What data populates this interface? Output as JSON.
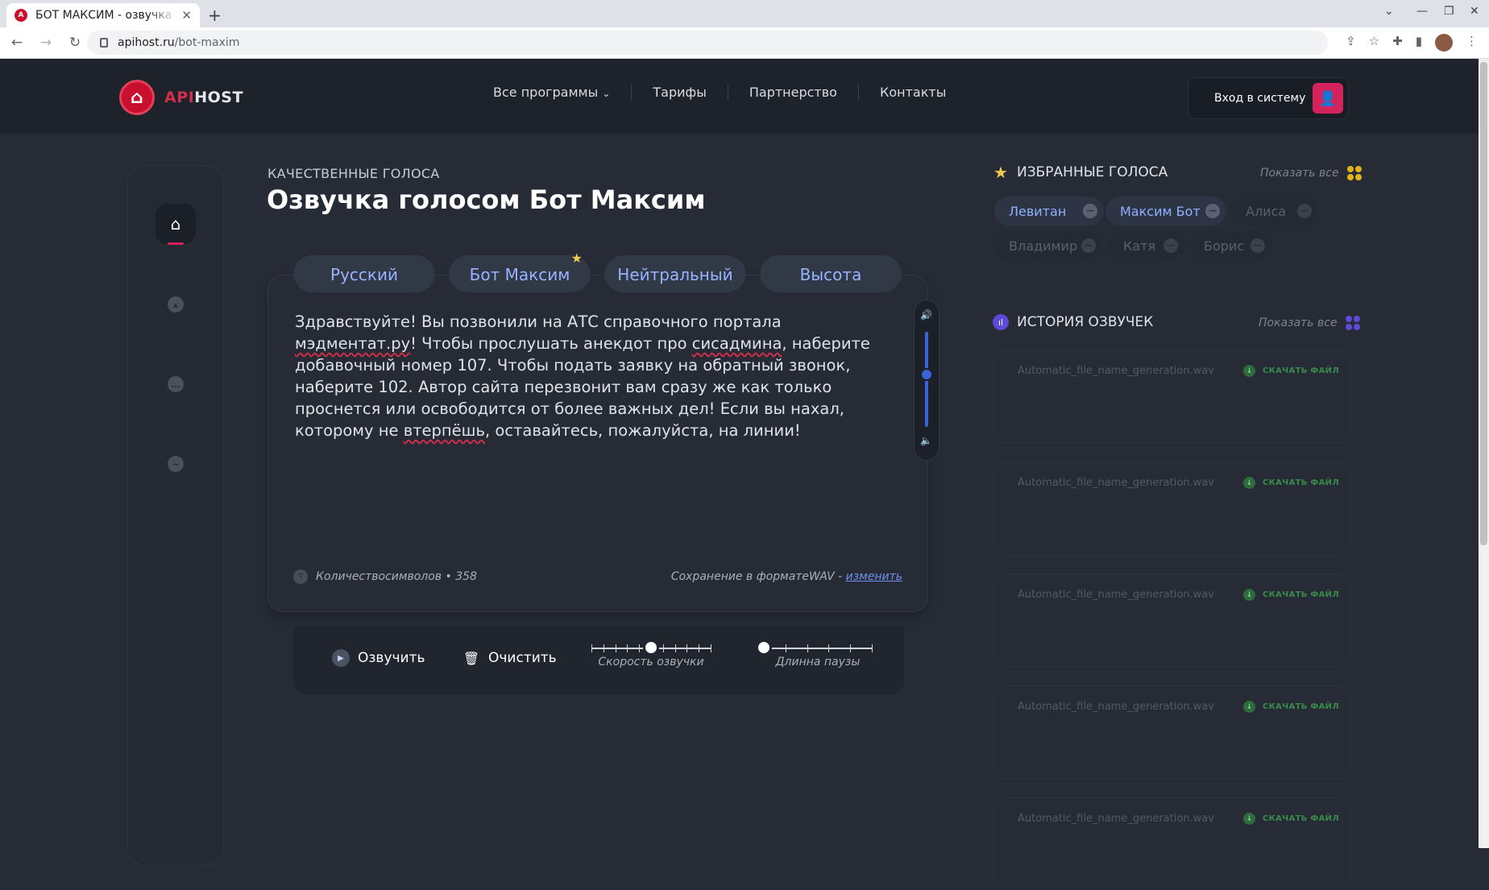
{
  "browser": {
    "tab_title": "БОТ МАКСИМ - озвучка те",
    "url_host": "apihost.ru",
    "url_path": "/bot-maxim"
  },
  "header": {
    "logo_a": "API",
    "logo_b": "HOST",
    "nav": [
      "Все программы",
      "Тарифы",
      "Партнерство",
      "Контакты"
    ],
    "login_label": "Вход в систему"
  },
  "page": {
    "eyebrow": "КАЧЕСТВЕННЫЕ ГОЛОСА",
    "title": "Озвучка голосом Бот Максим"
  },
  "voice_tabs": [
    "Русский",
    "Бот Максим",
    "Нейтральный",
    "Высота"
  ],
  "editor": {
    "text_parts": [
      {
        "t": "Здравствуйте! Вы позвонили на АТС справочного портала ",
        "s": false
      },
      {
        "t": "мэдментат.ру",
        "s": true
      },
      {
        "t": "! Чтобы прослушать анекдот про ",
        "s": false
      },
      {
        "t": "сисадмина",
        "s": true
      },
      {
        "t": ", наберите добавочный номер 107. Чтобы подать заявку на обратный звонок, наберите 102. Автор сайта перезвонит вам сразу же как только проснется или освободится от более важных дел! Если вы нахал, которому не ",
        "s": false
      },
      {
        "t": "втерпёшь",
        "s": true
      },
      {
        "t": ", оставайтесь, пожалуйста, на линии!",
        "s": false
      }
    ],
    "char_count_label": "Количествосимволов • 358",
    "save_prefix": "Сохранение в форматеWAV - ",
    "save_link": "изменить",
    "volume_level": 0.55
  },
  "actions": {
    "speak": "Озвучить",
    "clear": "Очистить",
    "speed_label": "Скорость озвучки",
    "speed_value": 0.5,
    "pause_label": "Длинна паузы",
    "pause_value": 0.0
  },
  "favorites": {
    "title": "ИЗБРАННЫЕ ГОЛОСА",
    "show_all": "Показать все",
    "chips": [
      {
        "label": "Левитан",
        "active": true
      },
      {
        "label": "Максим Бот",
        "active": true
      },
      {
        "label": "Алиса",
        "active": false
      },
      {
        "label": "Владимир",
        "active": false
      },
      {
        "label": "Катя",
        "active": false
      },
      {
        "label": "Борис",
        "active": false
      }
    ]
  },
  "history": {
    "title": "ИСТОРИЯ ОЗВУЧЕК",
    "show_all": "Показать все",
    "items": [
      {
        "file": "Automatic_file_name_generation.wav",
        "action": "СКАЧАТЬ ФАЙЛ"
      },
      {
        "file": "Automatic_file_name_generation.wav",
        "action": "СКАЧАТЬ ФАЙЛ"
      },
      {
        "file": "Automatic_file_name_generation.wav",
        "action": "СКАЧАТЬ ФАЙЛ"
      },
      {
        "file": "Automatic_file_name_generation.wav",
        "action": "СКАЧАТЬ ФАЙЛ"
      },
      {
        "file": "Automatic_file_name_generation.wav",
        "action": "СКАЧАТЬ ФАЙЛ"
      }
    ]
  },
  "colors": {
    "accent": "#d6225a",
    "tab_text": "#97b3ff",
    "link": "#6d8fee"
  }
}
